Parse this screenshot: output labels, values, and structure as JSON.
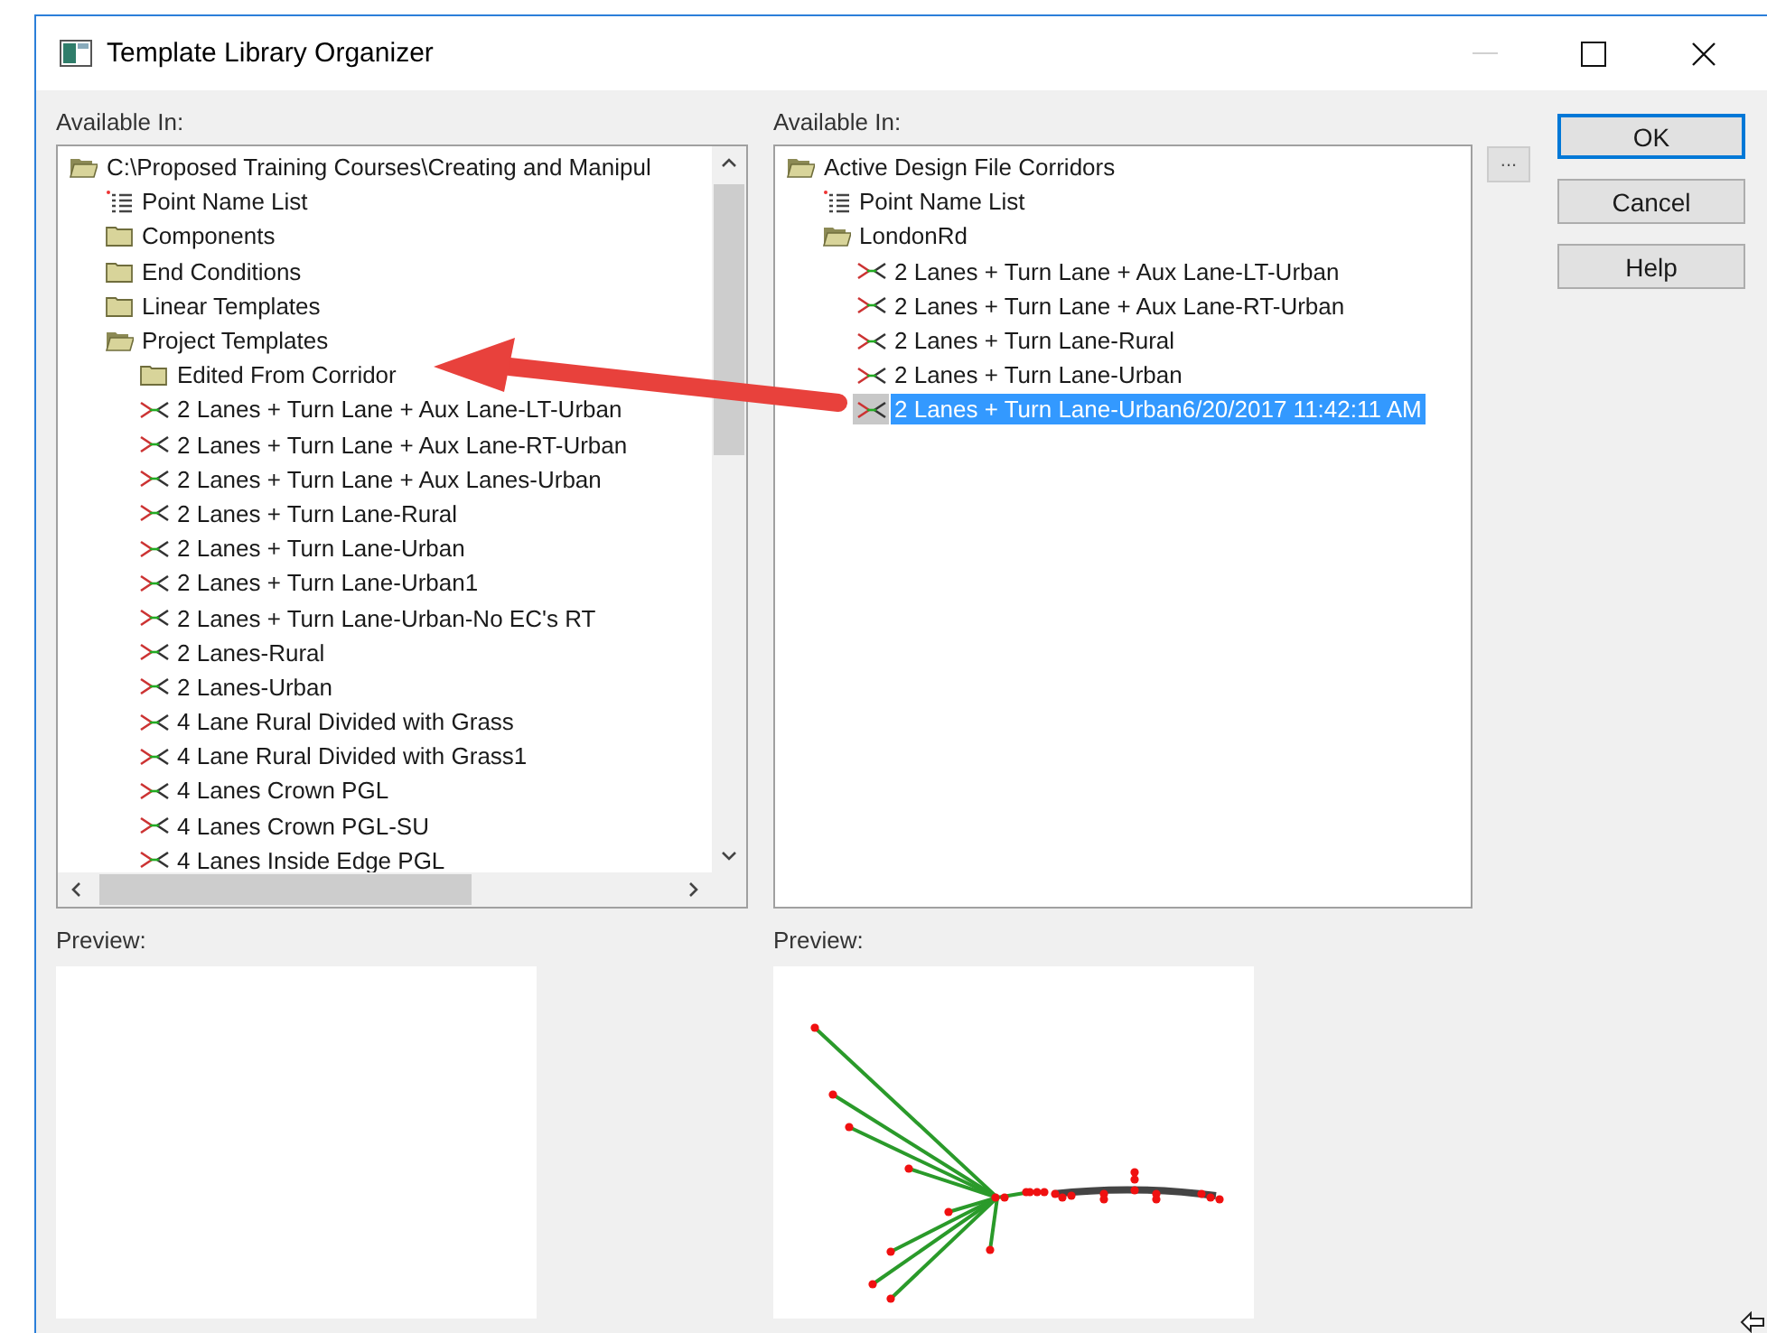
{
  "window": {
    "title": "Template Library Organizer"
  },
  "left_panel": {
    "label": "Available In:",
    "tree": [
      {
        "label": "C:\\Proposed Training Courses\\Creating and Manipul",
        "kind": "folder",
        "expanded": true,
        "selected": false,
        "children": [
          {
            "label": "Point Name List",
            "kind": "list",
            "selected": false
          },
          {
            "label": "Components",
            "kind": "folder",
            "expanded": false,
            "selected": false
          },
          {
            "label": "End Conditions",
            "kind": "folder",
            "expanded": false,
            "selected": false
          },
          {
            "label": "Linear Templates",
            "kind": "folder",
            "expanded": false,
            "selected": false
          },
          {
            "label": "Project Templates",
            "kind": "folder",
            "expanded": true,
            "selected": false,
            "children": [
              {
                "label": "Edited From Corridor",
                "kind": "folder",
                "expanded": false,
                "selected": false
              },
              {
                "label": "2 Lanes + Turn Lane + Aux Lane-LT-Urban",
                "kind": "template",
                "selected": false
              },
              {
                "label": "2 Lanes + Turn Lane + Aux Lane-RT-Urban",
                "kind": "template",
                "selected": false
              },
              {
                "label": "2 Lanes + Turn Lane + Aux Lanes-Urban",
                "kind": "template",
                "selected": false
              },
              {
                "label": "2 Lanes + Turn Lane-Rural",
                "kind": "template",
                "selected": false
              },
              {
                "label": "2 Lanes + Turn Lane-Urban",
                "kind": "template",
                "selected": false
              },
              {
                "label": "2 Lanes + Turn Lane-Urban1",
                "kind": "template",
                "selected": false
              },
              {
                "label": "2 Lanes + Turn Lane-Urban-No EC's RT",
                "kind": "template",
                "selected": false
              },
              {
                "label": "2 Lanes-Rural",
                "kind": "template",
                "selected": false
              },
              {
                "label": "2 Lanes-Urban",
                "kind": "template",
                "selected": false
              },
              {
                "label": "4 Lane Rural Divided with Grass",
                "kind": "template",
                "selected": false
              },
              {
                "label": "4 Lane Rural Divided with Grass1",
                "kind": "template",
                "selected": false
              },
              {
                "label": "4 Lanes Crown PGL",
                "kind": "template",
                "selected": false
              },
              {
                "label": "4 Lanes Crown PGL-SU",
                "kind": "template",
                "selected": false
              },
              {
                "label": "4 Lanes Inside Edge PGL",
                "kind": "template",
                "selected": false
              }
            ]
          }
        ]
      }
    ]
  },
  "right_panel": {
    "label": "Available In:",
    "tree": [
      {
        "label": "Active Design File Corridors",
        "kind": "folder",
        "expanded": true,
        "selected": false,
        "children": [
          {
            "label": "Point Name List",
            "kind": "list",
            "selected": false
          },
          {
            "label": "LondonRd",
            "kind": "folder",
            "expanded": true,
            "selected": false,
            "children": [
              {
                "label": "2 Lanes + Turn Lane + Aux Lane-LT-Urban",
                "kind": "template",
                "selected": false
              },
              {
                "label": "2 Lanes + Turn Lane + Aux Lane-RT-Urban",
                "kind": "template",
                "selected": false
              },
              {
                "label": "2 Lanes + Turn Lane-Rural",
                "kind": "template",
                "selected": false
              },
              {
                "label": "2 Lanes + Turn Lane-Urban",
                "kind": "template",
                "selected": false
              },
              {
                "label": "2 Lanes + Turn Lane-Urban6/20/2017 11:42:11 AM",
                "kind": "template",
                "selected": true
              }
            ]
          }
        ]
      }
    ]
  },
  "browse_button": "...",
  "buttons": [
    {
      "label": "OK",
      "default": true
    },
    {
      "label": "Cancel",
      "default": false
    },
    {
      "label": "Help",
      "default": false
    }
  ],
  "previews": [
    {
      "label": "Preview:",
      "kind": "empty"
    },
    {
      "label": "Preview:",
      "kind": "template"
    }
  ]
}
